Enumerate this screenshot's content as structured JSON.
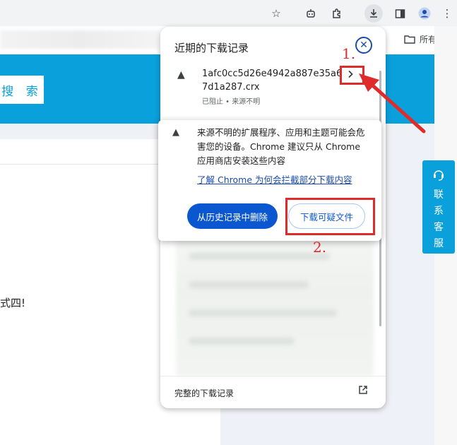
{
  "browser": {
    "icons": [
      "star-icon",
      "robot-icon",
      "puzzle-icon",
      "download-icon",
      "sidebar-icon",
      "profile-icon",
      "more-icon"
    ],
    "bookmark_folder": "所有书签"
  },
  "page": {
    "search_button": "搜 索",
    "body_fragment": "式四!",
    "contact_label": "联系客服",
    "accent_color": "#0aa0dc"
  },
  "download_panel": {
    "title": "近期的下载记录",
    "item": {
      "filename": "1afc0cc5d26e4942a887e35a67d1a287.crx",
      "status": "已阻止 • 来源不明"
    },
    "footer": "完整的下载记录"
  },
  "warning_popup": {
    "message": "来源不明的扩展程序、应用和主题可能会危害您的设备。Chrome 建议只从 Chrome 应用商店安装这些内容",
    "link": "了解 Chrome 为何会拦截部分下载内容",
    "delete_button": "从历史记录中删除",
    "download_button": "下载可疑文件",
    "primary_color": "#0b57d0"
  },
  "annotations": {
    "label_1": "1.",
    "label_2": "2.",
    "color": "#e02b2b"
  }
}
